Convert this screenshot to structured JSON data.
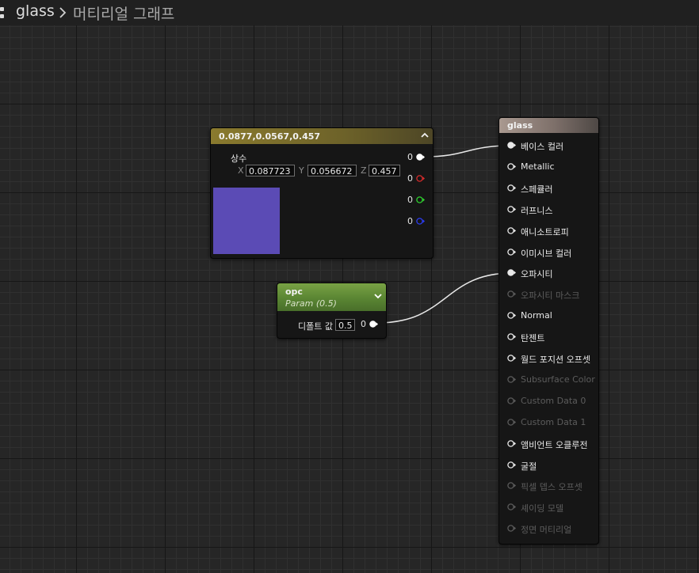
{
  "breadcrumb": {
    "asset": "glass",
    "graph": "머티리얼 그래프"
  },
  "constant_node": {
    "title": "0.0877,0.0567,0.457",
    "label": "상수",
    "x_label": "X",
    "x_value": "0.087723",
    "y_label": "Y",
    "y_value": "0.056672",
    "z_label": "Z",
    "z_value": "0.457",
    "color": "#5b4bb5",
    "outputs": [
      {
        "value": "0",
        "color": "#ffffff"
      },
      {
        "value": "0",
        "color": "#d62b2b"
      },
      {
        "value": "0",
        "color": "#2fd12f"
      },
      {
        "value": "0",
        "color": "#2c3cf0"
      }
    ]
  },
  "param_node": {
    "title": "opc",
    "subtitle": "Param (0.5)",
    "default_label": "디폴트 값",
    "default_value": "0.5",
    "output_value": "0"
  },
  "material_node": {
    "title": "glass",
    "inputs": [
      {
        "label": "베이스 컬러",
        "connected": true,
        "enabled": true
      },
      {
        "label": "Metallic",
        "connected": false,
        "enabled": true
      },
      {
        "label": "스페큘러",
        "connected": false,
        "enabled": true
      },
      {
        "label": "러프니스",
        "connected": false,
        "enabled": true
      },
      {
        "label": "애니소트로피",
        "connected": false,
        "enabled": true
      },
      {
        "label": "이미시브 컬러",
        "connected": false,
        "enabled": true
      },
      {
        "label": "오파시티",
        "connected": true,
        "enabled": true
      },
      {
        "label": "오파시티 마스크",
        "connected": false,
        "enabled": false
      },
      {
        "label": "Normal",
        "connected": false,
        "enabled": true
      },
      {
        "label": "탄젠트",
        "connected": false,
        "enabled": true
      },
      {
        "label": "월드 포지션 오프셋",
        "connected": false,
        "enabled": true
      },
      {
        "label": "Subsurface Color",
        "connected": false,
        "enabled": false
      },
      {
        "label": "Custom Data 0",
        "connected": false,
        "enabled": false
      },
      {
        "label": "Custom Data 1",
        "connected": false,
        "enabled": false
      },
      {
        "label": "앰비언트 오클루전",
        "connected": false,
        "enabled": true
      },
      {
        "label": "굴절",
        "connected": false,
        "enabled": true
      },
      {
        "label": "픽셀 뎁스 오프셋",
        "connected": false,
        "enabled": false
      },
      {
        "label": "셰이딩 모델",
        "connected": false,
        "enabled": false
      },
      {
        "label": "정면 머티리얼",
        "connected": false,
        "enabled": false
      }
    ]
  }
}
